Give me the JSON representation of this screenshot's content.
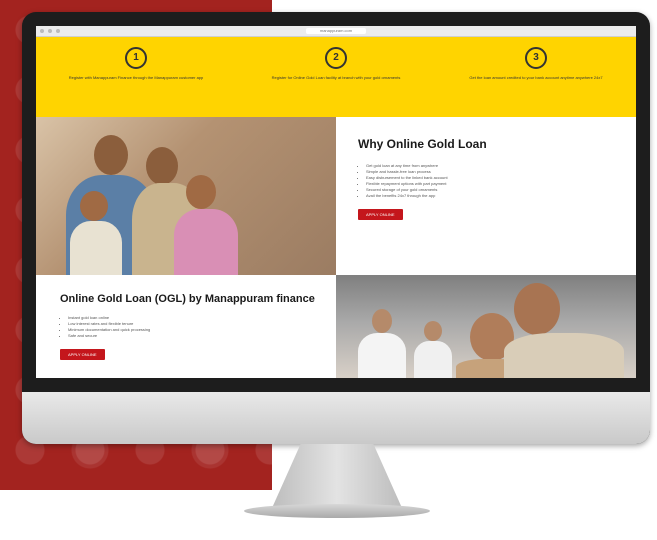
{
  "browser": {
    "url": "manappuram.com"
  },
  "steps": [
    {
      "number": "1",
      "text": "Register with Manappuram Finance through the Manappuram customer app"
    },
    {
      "number": "2",
      "text": "Register for Online Gold Loan facility at branch with your gold ornaments"
    },
    {
      "number": "3",
      "text": "Get the loan amount credited to your bank account anytime anywhere 24x7"
    }
  ],
  "why": {
    "title": "Why Online Gold Loan",
    "points": [
      "Get gold loan at any time from anywhere",
      "Simple and hassle-free loan process",
      "Easy disbursement to the linked bank account",
      "Flexible repayment options with part payment",
      "Secured storage of your gold ornaments",
      "Avail the benefits 24x7 through the app"
    ],
    "button": "APPLY ONLINE"
  },
  "dgl": {
    "title": "Online Gold Loan (OGL) by Manappuram finance",
    "points": [
      "Instant gold loan online",
      "Low interest rates and flexible tenure",
      "Minimum documentation and quick processing",
      "Safe and secure"
    ],
    "button": "APPLY ONLINE"
  },
  "colors": {
    "accent": "#c4161c",
    "band": "#ffd400",
    "backdrop": "#a3231f"
  }
}
